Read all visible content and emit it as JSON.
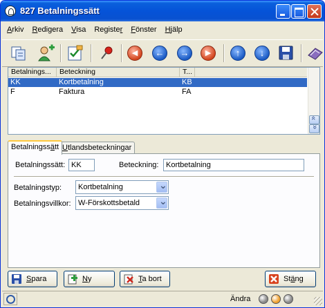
{
  "window": {
    "title": "827 Betalningssätt",
    "controls": [
      "minimize",
      "maximize",
      "close"
    ]
  },
  "menu": [
    {
      "pre": "",
      "u": "A",
      "post": "rkiv"
    },
    {
      "pre": "",
      "u": "R",
      "post": "edigera"
    },
    {
      "pre": "",
      "u": "V",
      "post": "isa"
    },
    {
      "pre": "Registe",
      "u": "r",
      "post": ""
    },
    {
      "pre": "",
      "u": "F",
      "post": "önster"
    },
    {
      "pre": "",
      "u": "H",
      "post": "jälp"
    }
  ],
  "toolbar": {
    "buttons": [
      "copy-icon",
      "add-user-icon",
      "checklist-icon",
      "pin-icon",
      "first-record-icon",
      "previous-record-icon",
      "next-record-icon",
      "last-record-icon",
      "move-up-icon",
      "move-down-icon",
      "save-icon",
      "print-icon"
    ]
  },
  "table": {
    "columns": [
      "Betalnings...",
      "Beteckning",
      "T..."
    ],
    "rows": [
      {
        "code": "KK",
        "name": "Kortbetalning",
        "type": "KB",
        "selected": true
      },
      {
        "code": "F",
        "name": "Faktura",
        "type": "FA",
        "selected": false
      }
    ]
  },
  "tabs": {
    "active": {
      "pre": "Betalningss",
      "u": "ä",
      "post": "tt"
    },
    "other": {
      "pre": "",
      "u": "U",
      "post": "tlandsbeteckningar"
    }
  },
  "form": {
    "method_label": "Betalningssätt:",
    "method_value": "KK",
    "name_label": "Beteckning:",
    "name_value": "Kortbetalning",
    "type_label": "Betalningstyp:",
    "type_value": "Kortbetalning",
    "terms_label": "Betalningsvillkor:",
    "terms_value": "W-Förskottsbetald"
  },
  "buttons": {
    "save": {
      "pre": "",
      "u": "S",
      "post": "para"
    },
    "new": {
      "pre": "",
      "u": "N",
      "post": "y"
    },
    "delete": {
      "pre": "",
      "u": "T",
      "post": "a bort"
    },
    "close": {
      "pre": "St",
      "u": "ä",
      "post": "ng"
    }
  },
  "status": {
    "mode": "Ändra",
    "lights": [
      "#8a8a8a",
      "#f2a230",
      "#8a8a8a"
    ]
  },
  "colors": {
    "selection": "#316ac5",
    "titlebar": "#0553d8",
    "window_bg": "#ece9d8"
  }
}
